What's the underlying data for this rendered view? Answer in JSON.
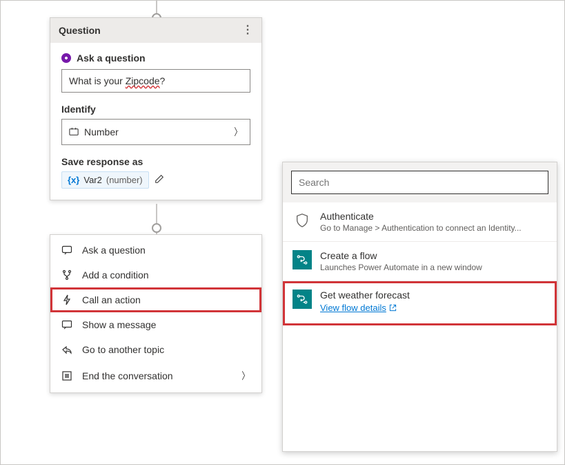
{
  "question_card": {
    "header_title": "Question",
    "ask_label": "Ask a question",
    "question_text_prefix": "What is your ",
    "question_typo_word": "Zipcode",
    "question_text_suffix": "?",
    "identify_label": "Identify",
    "identify_value": "Number",
    "save_label": "Save response as",
    "variable_name": "Var2",
    "variable_type": "(number)"
  },
  "action_menu": {
    "items": [
      {
        "label": "Ask a question",
        "icon": "chat"
      },
      {
        "label": "Add a condition",
        "icon": "branch"
      },
      {
        "label": "Call an action",
        "icon": "lightning",
        "highlighted": true
      },
      {
        "label": "Show a message",
        "icon": "message"
      },
      {
        "label": "Go to another topic",
        "icon": "redo"
      },
      {
        "label": "End the conversation",
        "icon": "list",
        "has_chevron": true
      }
    ]
  },
  "flyout": {
    "search_placeholder": "Search",
    "items": [
      {
        "icon": "shield",
        "title": "Authenticate",
        "subtitle": "Go to Manage > Authentication to connect an Identity..."
      },
      {
        "icon": "flow",
        "title": "Create a flow",
        "subtitle": "Launches Power Automate in a new window"
      },
      {
        "icon": "flow",
        "title": "Get weather forecast",
        "link": "View flow details",
        "highlighted": true
      }
    ]
  }
}
